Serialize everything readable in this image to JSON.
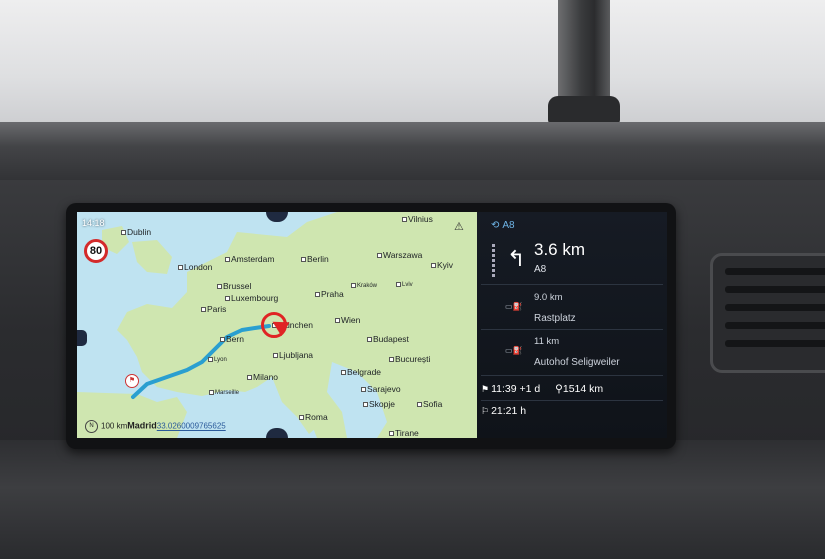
{
  "status": {
    "time": "14:18",
    "speed_limit": "80"
  },
  "map": {
    "cities": [
      "Dublin",
      "Vilnius",
      "London",
      "Amsterdam",
      "Berlin",
      "Warszawa",
      "Kyiv",
      "Brussel",
      "Praha",
      "Kraków",
      "Lviv",
      "Paris",
      "Luxembourg",
      "München",
      "Wien",
      "Bern",
      "Budapest",
      "Lyon",
      "Ljubljana",
      "București",
      "Milano",
      "Belgrade",
      "Marseille",
      "Sarajevo",
      "Skopje",
      "Sofia",
      "Roma",
      "Tirane"
    ],
    "scale": {
      "distance": "100 km",
      "place": "Madrid",
      "coords": "33.0260009765625"
    }
  },
  "colors": {
    "route": "#2a9fd0",
    "position_marker": "#e02424",
    "water": "#bfe3f1",
    "land": "#cfe6b0"
  },
  "icons": [
    "speed-limit-icon",
    "route-icon",
    "turn-left-icon",
    "rest-area-icon",
    "flag-icon",
    "location-pin-icon",
    "traffic-icon",
    "compass-icon"
  ],
  "guidance": {
    "road": "A8",
    "next_distance": "3.6 km",
    "next_road": "A8",
    "pois": [
      {
        "distance": "9.0 km",
        "name": "Rastplatz"
      },
      {
        "distance": "11 km",
        "name": "Autohof Seligweiler"
      }
    ],
    "arrival_time": "11:39 +1 d",
    "remaining_distance": "1514 km",
    "travel_time": "21:21 h"
  }
}
